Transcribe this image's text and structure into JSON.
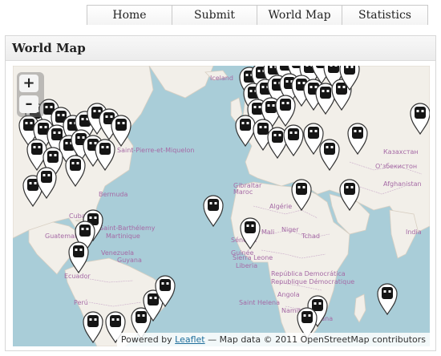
{
  "nav": {
    "tabs": [
      {
        "label": "Home"
      },
      {
        "label": "Submit"
      },
      {
        "label": "World Map"
      },
      {
        "label": "Statistics"
      }
    ]
  },
  "panel": {
    "title": "World Map"
  },
  "map": {
    "zoom_in_label": "+",
    "zoom_out_label": "–",
    "attribution": {
      "prefix": "Powered by ",
      "link": "Leaflet",
      "suffix": " — Map data © 2011 OpenStreetMap contributors"
    },
    "place_labels": [
      "Iceland",
      "Bermuda",
      "Saint-Pierre-et-Miquelon",
      "Gibraltar",
      "Maroc",
      "Algérie",
      "Mali",
      "Niger",
      "Tchad",
      "Sénégal",
      "Guinée",
      "Cuba",
      "Guatemala",
      "Venezuela",
      "Guyana",
      "Martinique",
      "Saint-Barthélemy",
      "Sierra Leone",
      "Liberia",
      "Ecuador",
      "Perú",
      "República Democrática",
      "Angola",
      "Saint Helena",
      "Namibia",
      "Botswana",
      "Republique Démocratique",
      "Казахстан",
      "Оʻзбекистон",
      "Afghanistan",
      "India"
    ],
    "colors": {
      "water": "#a9cdd8",
      "land": "#f2efe9",
      "marker_fill": "#ffffff",
      "marker_icon": "#151515"
    }
  }
}
